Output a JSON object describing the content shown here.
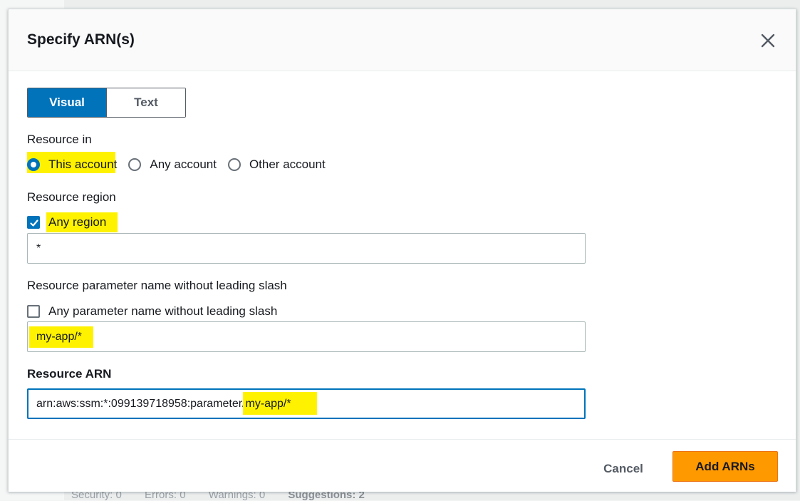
{
  "background": {
    "footer_items": [
      "Security: 0",
      "Errors: 0",
      "Warnings: 0",
      "Suggestions: 2"
    ]
  },
  "modal": {
    "title": "Specify ARN(s)",
    "close_icon": "close-icon",
    "mode_toggle": {
      "options": [
        "Visual",
        "Text"
      ],
      "selected": "Visual"
    },
    "resource_in": {
      "label": "Resource in",
      "options": [
        "This account",
        "Any account",
        "Other account"
      ],
      "selected": "This account"
    },
    "resource_region": {
      "label": "Resource region",
      "checkbox_label": "Any region",
      "checked": true,
      "value": "*"
    },
    "resource_parameter": {
      "label": "Resource parameter name without leading slash",
      "checkbox_label": "Any parameter name without leading slash",
      "checked": false,
      "value": "my-app/*"
    },
    "resource_arn": {
      "label": "Resource ARN",
      "value_prefix": "arn:aws:ssm:*:099139718958:parameter/",
      "value_highlight": "my-app/*"
    },
    "footer": {
      "cancel_label": "Cancel",
      "add_label": "Add ARNs"
    },
    "colors": {
      "accent": "#0073bb",
      "primary_button": "#ff9900",
      "highlight": "#fff200"
    }
  }
}
